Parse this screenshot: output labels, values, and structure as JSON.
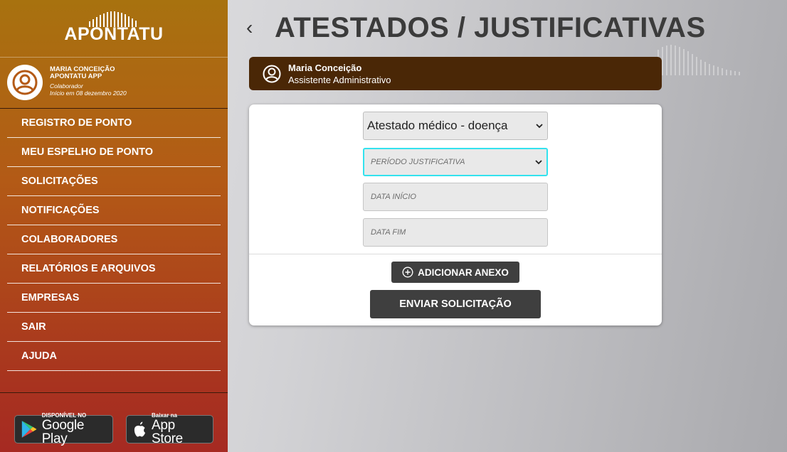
{
  "app": {
    "logo_text": "APONTATU"
  },
  "user": {
    "name": "MARIA CONCEIçãO",
    "company": "APONTATU APP",
    "role": "Colaborador",
    "start": "Início em 08 dezembro 2020"
  },
  "menu": {
    "items": [
      {
        "label": "REGISTRO DE PONTO"
      },
      {
        "label": "MEU ESPELHO DE PONTO"
      },
      {
        "label": "SOLICITAÇÕES"
      },
      {
        "label": "NOTIFICAÇÕES"
      },
      {
        "label": "COLABORADORES"
      },
      {
        "label": "RELATÓRIOS E ARQUIVOS"
      },
      {
        "label": "EMPRESAS"
      },
      {
        "label": "SAIR"
      },
      {
        "label": "AJUDA"
      }
    ]
  },
  "stores": {
    "google_small": "DISPONÍVEL NO",
    "google_big": "Google Play",
    "apple_small": "Baixar na",
    "apple_big": "App Store"
  },
  "page": {
    "title": "ATESTADOS / JUSTIFICATIVAS",
    "back_icon": "chevron-left-icon"
  },
  "employee": {
    "name": "Maria Conceição",
    "role": "Assistente Administrativo"
  },
  "form": {
    "type_value": "Atestado médico - doença",
    "period_placeholder": "PERÍODO JUSTIFICATIVA",
    "start_placeholder": "DATA INÍCIO",
    "end_placeholder": "DATA FIM",
    "attach_label": "ADICIONAR ANEXO",
    "send_label": "ENVIAR SOLICITAÇÃO"
  },
  "colors": {
    "sidebar_top": "#a8720f",
    "sidebar_bottom": "#a62a22",
    "employee_bar": "#4a2706",
    "focus_border": "#33e2ee",
    "button": "#3f3f3f"
  }
}
